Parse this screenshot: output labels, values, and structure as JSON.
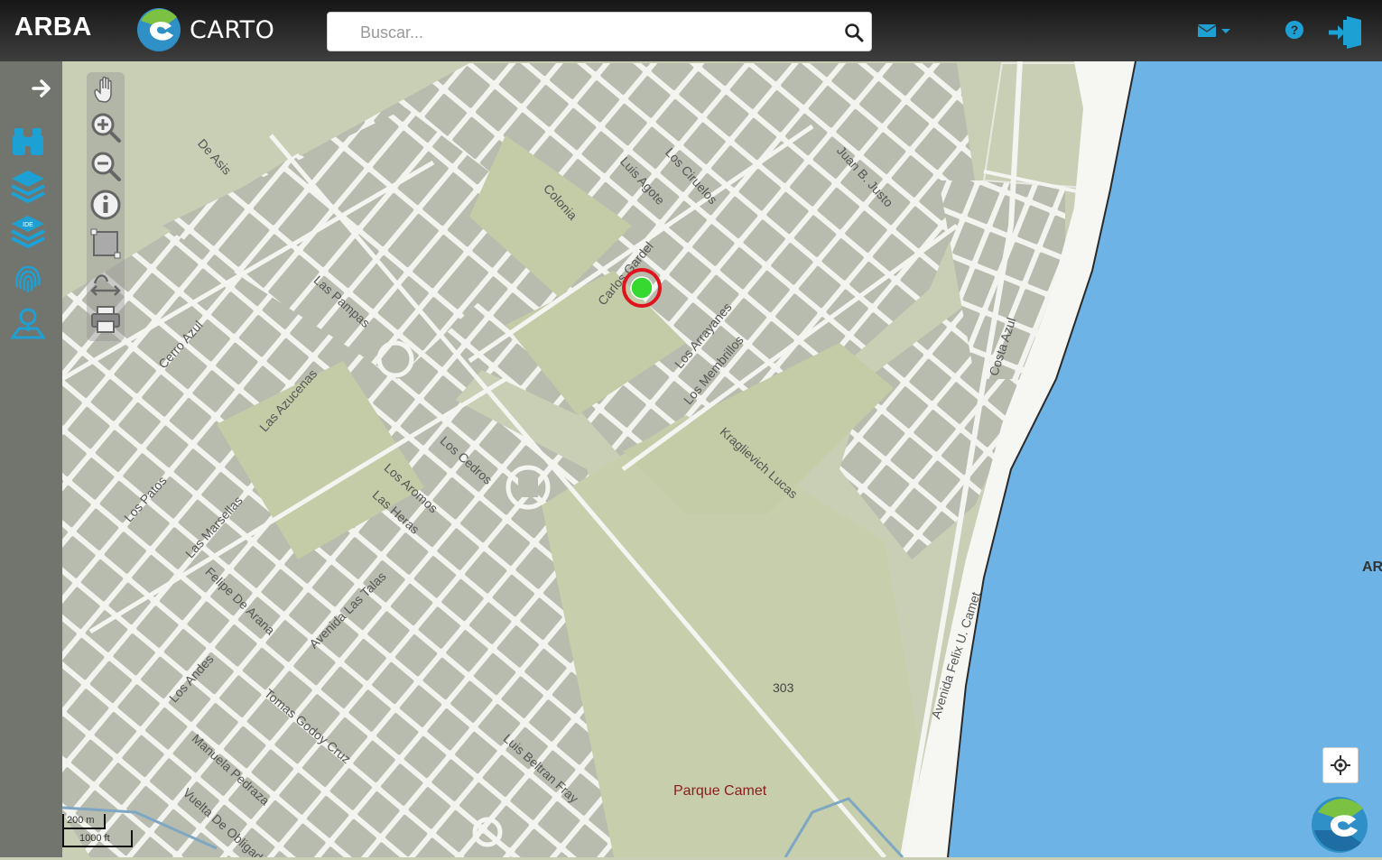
{
  "header": {
    "brand": "ARBA",
    "app_name": "CARTO",
    "search_placeholder": "Buscar..."
  },
  "map": {
    "poi_label": "Parque Camet",
    "number_label": "303",
    "edge_label": "AR",
    "scale_metric": "200 m",
    "scale_imperial": "1000 ft",
    "street_labels": [
      "Avenida Felix U. Camet",
      "Kraglievich Lucas",
      "Luis Beltran Fray",
      "Tomas Godoy Cruz",
      "Felipe De Arana",
      "Avenida Las Talas",
      "Las Heras",
      "Los Cedros",
      "Cerro Azul",
      "Las Marsellas",
      "Las Pampas",
      "Los Patos",
      "Vuelta De Obligado",
      "Manuela Pedraza",
      "Los Andes",
      "Los Aromos",
      "Las Azucenas",
      "Luis Agote",
      "De Asis",
      "Los Ciruelos",
      "Juan B. Justo",
      "Carlos Gardel",
      "Los Membrillos",
      "Colonia",
      "Los Arrayanes",
      "Costa Azul"
    ]
  },
  "colors": {
    "water": "#6db3e6",
    "land": "#c9cfb4",
    "block": "#b8bcae",
    "road": "#f4f4f1",
    "accent": "#1da1d5",
    "marker_ring": "#e0141e",
    "marker_dot": "#35d92f"
  },
  "icons": {
    "sidebar": [
      "arrow-right-icon",
      "binoculars-icon",
      "layers-icon",
      "ide-layers-icon",
      "fingerprint-icon",
      "map-location-icon"
    ],
    "tools": [
      "pan-hand-icon",
      "zoom-in-icon",
      "zoom-out-icon",
      "info-icon",
      "select-area-icon",
      "measure-icon",
      "print-icon"
    ]
  }
}
